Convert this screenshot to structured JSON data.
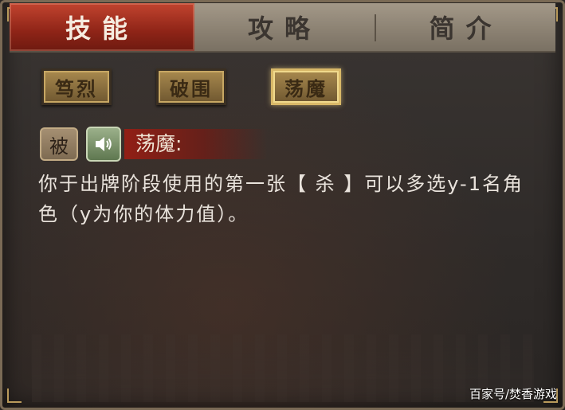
{
  "tabs": [
    {
      "label": "技能",
      "active": true
    },
    {
      "label": "攻略",
      "active": false
    },
    {
      "label": "简介",
      "active": false
    }
  ],
  "skill_buttons": [
    {
      "label": "笃烈",
      "selected": false
    },
    {
      "label": "破围",
      "selected": false
    },
    {
      "label": "荡魔",
      "selected": true
    }
  ],
  "skill_detail": {
    "type_badge": "被",
    "sound_icon": "speaker-icon",
    "name": "荡魔:",
    "description": "你于出牌阶段使用的第一张【 杀 】可以多选y-1名角色（y为你的体力值）。"
  },
  "watermark": "百家号/焚香游戏",
  "colors": {
    "active_tab": "#8e2417",
    "button_gold": "#a8894e",
    "text": "#e9e3dc"
  }
}
